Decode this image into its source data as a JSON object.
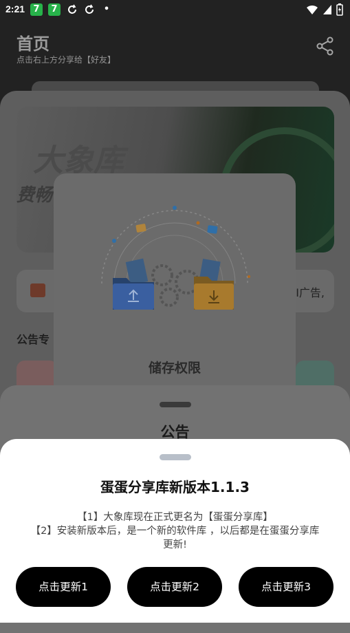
{
  "status_bar": {
    "time": "2:21",
    "app_badge_1": "7",
    "app_badge_2": "7",
    "dot": "•"
  },
  "header": {
    "title": "首页",
    "subtitle": "点击右上方分享给【好友】"
  },
  "banner": {
    "title": "大象库",
    "subtitle": "费畅"
  },
  "notice_row": {
    "text_tail": "I广告,"
  },
  "section": {
    "title": "公告专"
  },
  "permission_dialog": {
    "title": "储存权限"
  },
  "notice_sheet": {
    "title": "公告"
  },
  "update_sheet": {
    "title": "蛋蛋分享库新版本1.1.3",
    "line1": "【1】大象库现在正式更名为【蛋蛋分享库】",
    "line2": "【2】安装新版本后，是一个新的软件库 ，以后都是在蛋蛋分享库",
    "line3": "更新!",
    "buttons": [
      "点击更新1",
      "点击更新2",
      "点击更新3"
    ]
  },
  "colors": {
    "accent_green": "#27b24a",
    "upload_folder": "#3c6fd4",
    "download_folder": "#f2a93b",
    "button_bg": "#000000"
  }
}
